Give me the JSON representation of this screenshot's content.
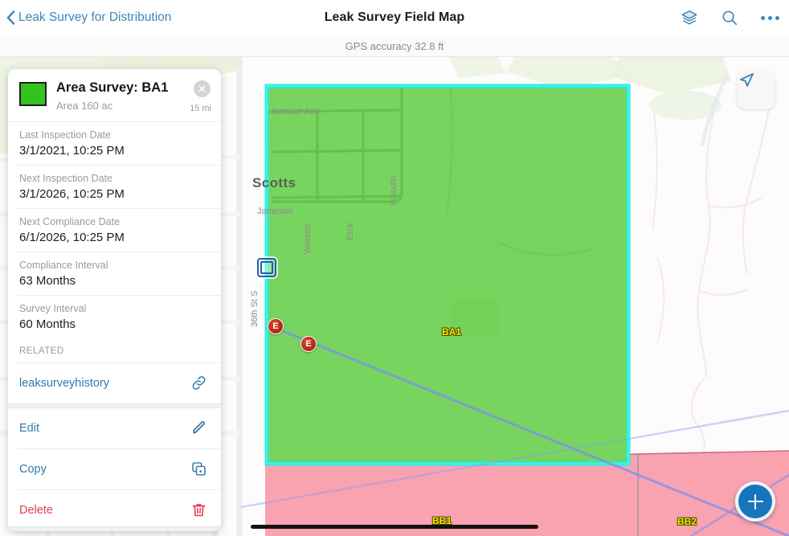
{
  "navbar": {
    "back_label": "Leak Survey for Distribution",
    "title": "Leak Survey Field Map",
    "back_icon": "chevron-left-icon",
    "layers_icon": "layers-icon",
    "search_icon": "search-icon",
    "more_icon": "more-horizontal-icon"
  },
  "status": {
    "gps_text": "GPS accuracy 32.8 ft"
  },
  "map": {
    "location_button_icon": "navigation-arrow-icon",
    "add_button_icon": "plus-icon",
    "colors": {
      "selected_fill": "#77d45e",
      "selected_outline": "#22efe4",
      "pink_fill": "#f9a3b0",
      "pink_outline": "#c4707e",
      "route_line": "#7b8ff0",
      "land_tint": "#eaf2dc",
      "background": "#fdfbfb"
    },
    "street_labels": [
      "Norscot Ave",
      "Jameson",
      "Watson",
      "Erck",
      "Woodin",
      "36th St S"
    ],
    "city_label": "Scotts",
    "polygon_labels": [
      "BA1",
      "BB1",
      "BB2"
    ],
    "markers": [
      {
        "label": "E",
        "name": "leak-marker-e-1"
      },
      {
        "label": "E",
        "name": "leak-marker-e-2"
      }
    ],
    "selected_vertex": "selected-vertex-handle"
  },
  "popup": {
    "title": "Area Survey: BA1",
    "subtitle": "Area 160 ac",
    "distance": "15 mi",
    "swatch_color": "#32c321",
    "close_icon": "close-icon",
    "fields": [
      {
        "label": "Last Inspection Date",
        "value": "3/1/2021, 10:25 PM"
      },
      {
        "label": "Next Inspection Date",
        "value": "3/1/2026, 10:25 PM"
      },
      {
        "label": "Next Compliance Date",
        "value": "6/1/2026, 10:25 PM"
      },
      {
        "label": "Compliance Interval",
        "value": "63 Months"
      },
      {
        "label": "Survey Interval",
        "value": "60 Months"
      }
    ],
    "related_header": "RELATED",
    "related": [
      {
        "label": "leaksurveyhistory",
        "icon": "link-icon"
      }
    ],
    "actions": [
      {
        "label": "Edit",
        "icon": "pencil-icon",
        "style": "link"
      },
      {
        "label": "Copy",
        "icon": "copy-icon",
        "style": "link"
      },
      {
        "label": "Delete",
        "icon": "trash-icon",
        "style": "danger"
      }
    ]
  }
}
